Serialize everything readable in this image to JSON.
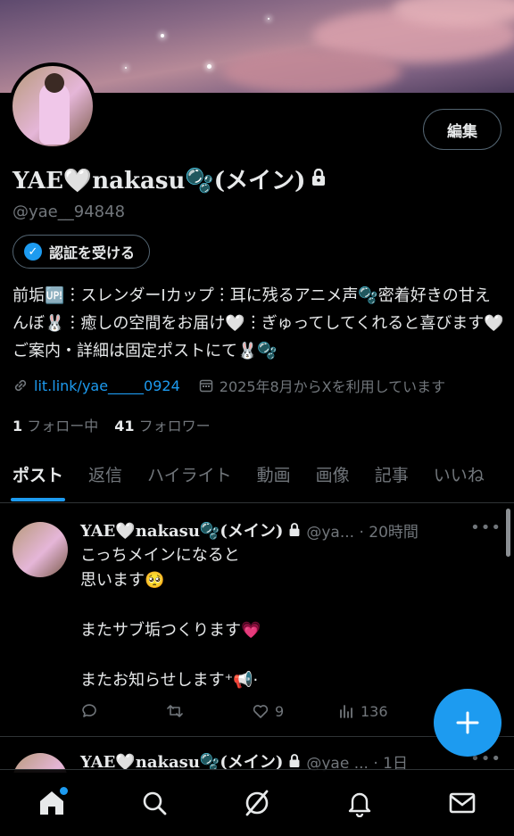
{
  "profile": {
    "name": "YAE🤍nakasu🫧(メイン)",
    "handle": "@yae__94848",
    "edit_label": "編集",
    "verify_label": "認証を受ける",
    "bio": "前垢🆙︙スレンダーIカップ︙耳に残るアニメ声🫧密着好きの甘えんぼ🐰︙癒しの空間をお届け🤍︙ぎゅってしてくれると喜びます🤍 ご案内・詳細は固定ポストにて🐰🫧",
    "link": "lit.link/yae_____0924",
    "joined": "2025年8月からXを利用しています",
    "following_count": "1",
    "following_label": "フォロー中",
    "followers_count": "41",
    "followers_label": "フォロワー"
  },
  "tabs": [
    {
      "label": "ポスト",
      "active": true
    },
    {
      "label": "返信"
    },
    {
      "label": "ハイライト"
    },
    {
      "label": "動画"
    },
    {
      "label": "画像"
    },
    {
      "label": "記事"
    },
    {
      "label": "いいね"
    }
  ],
  "posts": [
    {
      "name": "YAE🤍nakasu🫧(メイン)",
      "meta": "@ya... · 20時間",
      "text": "こっちメインになると\n思います🥺\n\nまたサブ垢つくります💗\n\nまたお知らせします⁺📢·",
      "replies": "",
      "reposts": "",
      "likes": "9",
      "views": "136"
    },
    {
      "name": "YAE🤍nakasu🫧(メイン)",
      "meta": "@yae     ... · 1日"
    }
  ],
  "colors": {
    "accent": "#1d9bf0",
    "background": "#000000",
    "muted": "#71767b"
  }
}
